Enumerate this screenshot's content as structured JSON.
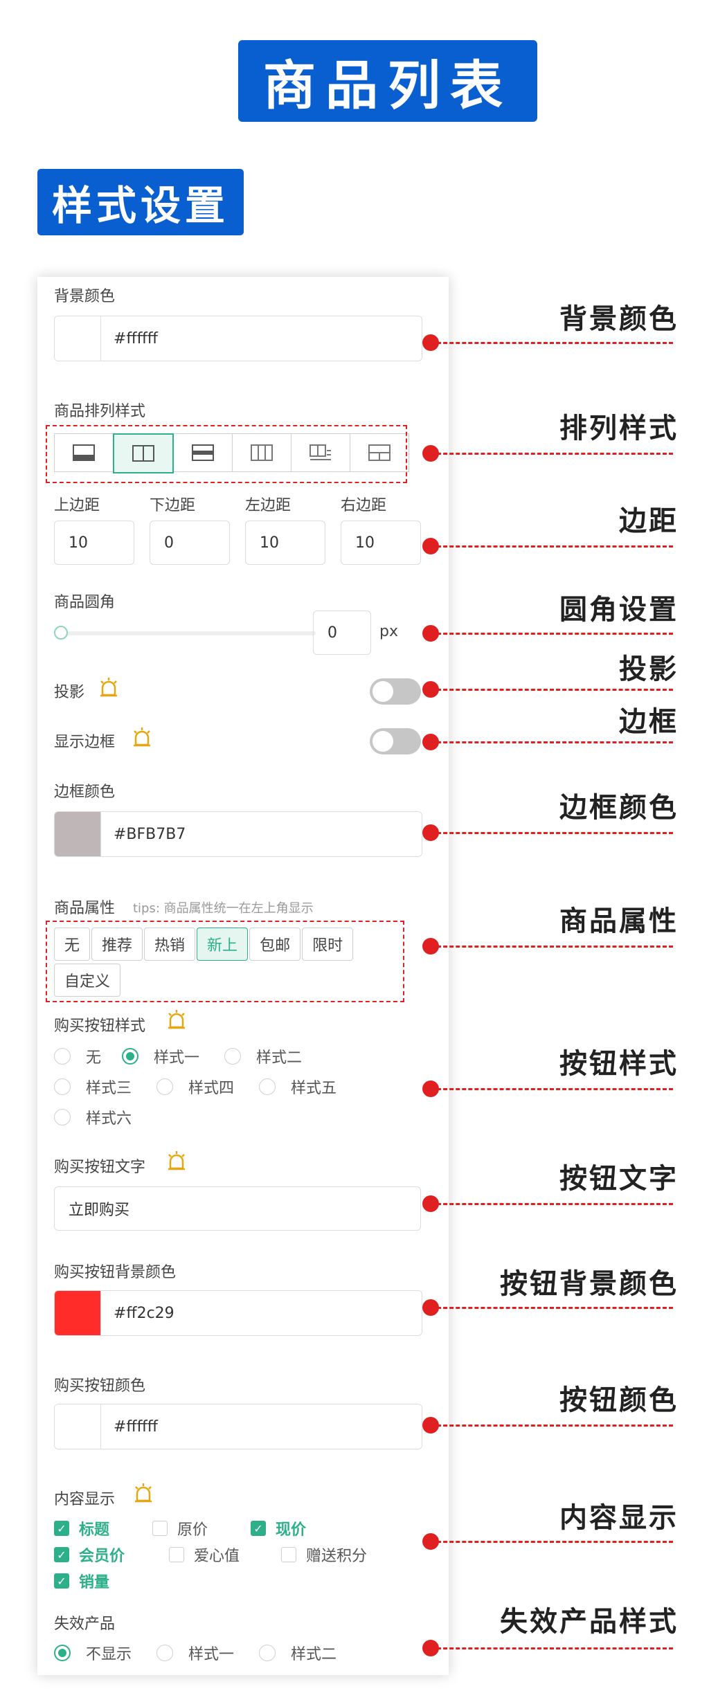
{
  "header": {
    "title": "商品列表",
    "section": "样式设置"
  },
  "colors": {
    "brand": "#0a5fd0",
    "accent": "#2db08a",
    "marker": "#e02020"
  },
  "panel": {
    "bg_color": {
      "label": "背景颜色",
      "value": "#ffffff",
      "swatch": "#ffffff"
    },
    "layout": {
      "label": "商品排列样式",
      "options": [
        "layout-1",
        "layout-2",
        "layout-3",
        "layout-4",
        "layout-5",
        "layout-6"
      ],
      "selected_index": 1
    },
    "margins": [
      {
        "label": "上边距",
        "value": "10"
      },
      {
        "label": "下边距",
        "value": "0"
      },
      {
        "label": "左边距",
        "value": "10"
      },
      {
        "label": "右边距",
        "value": "10"
      }
    ],
    "radius": {
      "label": "商品圆角",
      "value": "0",
      "unit": "px"
    },
    "shadow": {
      "label": "投影",
      "on": false
    },
    "border": {
      "label": "显示边框",
      "on": false
    },
    "border_color": {
      "label": "边框颜色",
      "value": "#BFB7B7",
      "swatch": "#BFB7B7"
    },
    "attr": {
      "label": "商品属性",
      "tips": "tips: 商品属性统一在左上角显示",
      "tags": [
        "无",
        "推荐",
        "热销",
        "新上",
        "包邮",
        "限时",
        "自定义"
      ],
      "selected": "新上"
    },
    "buy_style": {
      "label": "购买按钮样式",
      "options": [
        "无",
        "样式一",
        "样式二",
        "样式三",
        "样式四",
        "样式五",
        "样式六"
      ],
      "selected": "样式一"
    },
    "buy_text": {
      "label": "购买按钮文字",
      "value": "立即购买"
    },
    "buy_bg": {
      "label": "购买按钮背景颜色",
      "value": "#ff2c29",
      "swatch": "#ff2c29"
    },
    "buy_color": {
      "label": "购买按钮颜色",
      "value": "#ffffff",
      "swatch": "#ffffff"
    },
    "content": {
      "label": "内容显示",
      "items": [
        {
          "text": "标题",
          "checked": true
        },
        {
          "text": "原价",
          "checked": false
        },
        {
          "text": "现价",
          "checked": true
        },
        {
          "text": "会员价",
          "checked": true
        },
        {
          "text": "爱心值",
          "checked": false
        },
        {
          "text": "赠送积分",
          "checked": false
        },
        {
          "text": "销量",
          "checked": true
        }
      ]
    },
    "invalid": {
      "label": "失效产品",
      "options": [
        "不显示",
        "样式一",
        "样式二"
      ],
      "selected": "不显示"
    }
  },
  "annotations": [
    "背景颜色",
    "排列样式",
    "边距",
    "圆角设置",
    "投影",
    "边框",
    "边框颜色",
    "商品属性",
    "按钮样式",
    "按钮文字",
    "按钮背景颜色",
    "按钮颜色",
    "内容显示",
    "失效产品样式"
  ]
}
